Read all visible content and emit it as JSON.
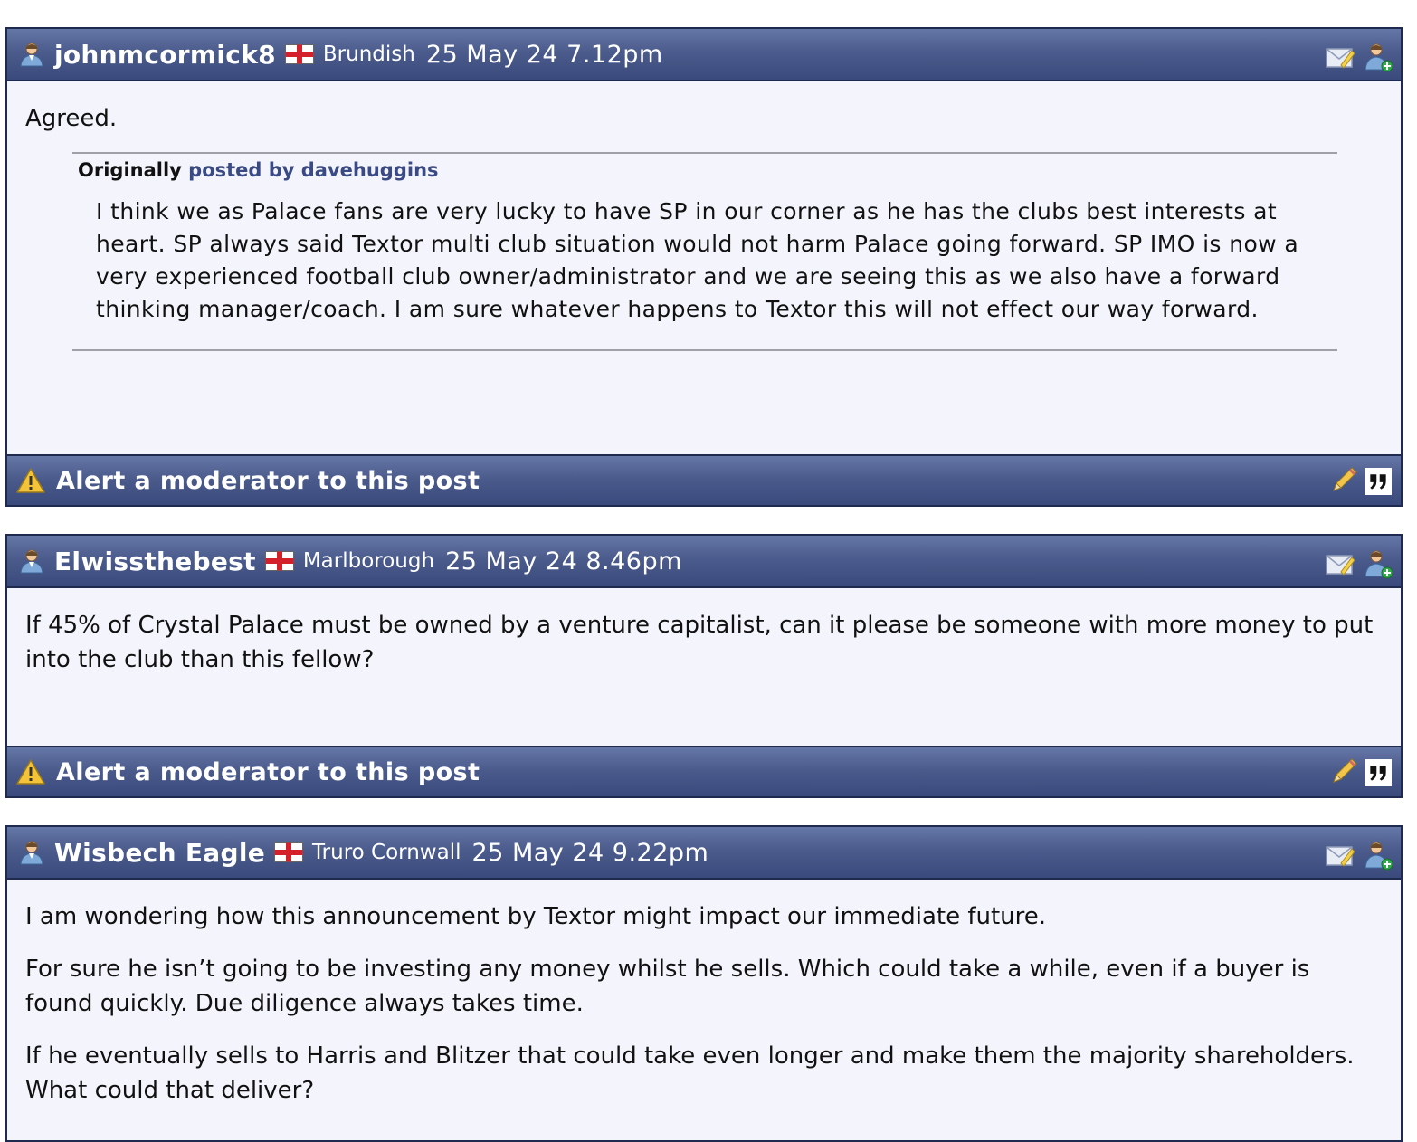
{
  "posts": [
    {
      "username": "johnmcormick8",
      "location": "Brundish",
      "date": "25 May 24 7.12pm",
      "paragraphs": [
        "Agreed."
      ],
      "quote": {
        "originally": "Originally",
        "posted_by": "posted by davehuggins",
        "text": "I think we as Palace fans are very lucky to have SP in our corner as he has the clubs best interests at heart. SP always said Textor multi club situation would not harm Palace going forward. SP IMO is now a very experienced football club owner/administrator and we are seeing this as we also have a forward thinking manager/coach. I am sure whatever happens to Textor this will not effect our way forward."
      },
      "alert_label": "Alert a moderator to this post"
    },
    {
      "username": "Elwissthebest",
      "location": "Marlborough",
      "date": "25 May 24 8.46pm",
      "paragraphs": [
        "If 45% of Crystal Palace must be owned by a venture capitalist, can it please be someone with more money to put into the club than this fellow?"
      ],
      "alert_label": "Alert a moderator to this post"
    },
    {
      "username": "Wisbech Eagle",
      "location": "Truro Cornwall",
      "date": "25 May 24 9.22pm",
      "paragraphs": [
        "I am wondering how this announcement by Textor might impact our immediate future.",
        "For sure he isn’t going to be investing any money whilst he sells. Which could take a while, even if a buyer is found quickly. Due diligence always takes time.",
        "If he eventually sells to Harris and Blitzer that could take even longer and make them the majority shareholders. What could that deliver?"
      ]
    }
  ],
  "icons": {
    "user": "user-icon",
    "flag": "england-flag-icon",
    "pm": "private-message-icon",
    "add_friend": "add-friend-icon",
    "alert": "warning-icon",
    "edit": "pencil-edit-icon",
    "quote": "quote-icon"
  },
  "colors": {
    "header_bar": "#4a5a8b",
    "post_background": "#f4f5fc",
    "border": "#1e2a4e",
    "quote_author": "#3a4a84"
  }
}
